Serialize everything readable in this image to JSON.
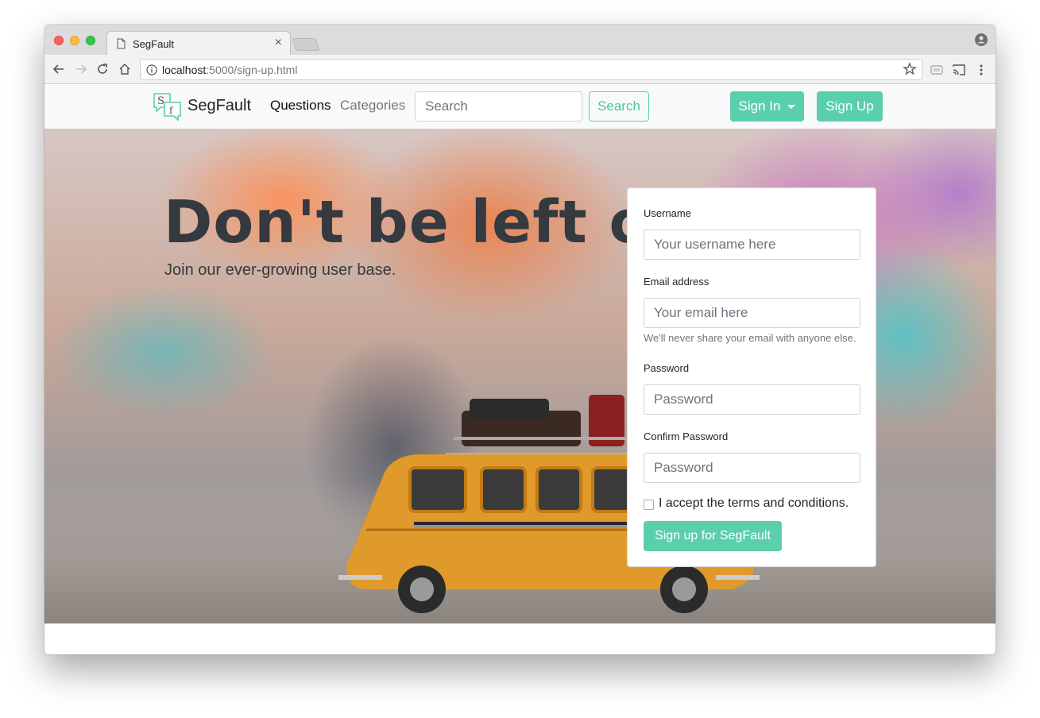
{
  "browser": {
    "tab_title": "SegFault",
    "tab_close": "×",
    "url_host": "localhost",
    "url_path": ":5000/sign-up.html"
  },
  "navbar": {
    "brand": "SegFault",
    "links": [
      "Questions",
      "Categories"
    ],
    "search_placeholder": "Search",
    "search_button": "Search",
    "signin_button": "Sign In",
    "signup_button": "Sign Up"
  },
  "hero": {
    "title": "Don't be left out!",
    "subtitle": "Join our ever-growing user base."
  },
  "form": {
    "username_label": "Username",
    "username_placeholder": "Your username here",
    "email_label": "Email address",
    "email_placeholder": "Your email here",
    "email_help": "We'll never share your email with anyone else.",
    "password_label": "Password",
    "password_placeholder": "Password",
    "confirm_label": "Confirm Password",
    "confirm_placeholder": "Password",
    "terms_label": "I accept the terms and conditions.",
    "submit_button": "Sign up for SegFault"
  },
  "colors": {
    "accent": "#5bcfab",
    "text_dark": "#343a40"
  }
}
